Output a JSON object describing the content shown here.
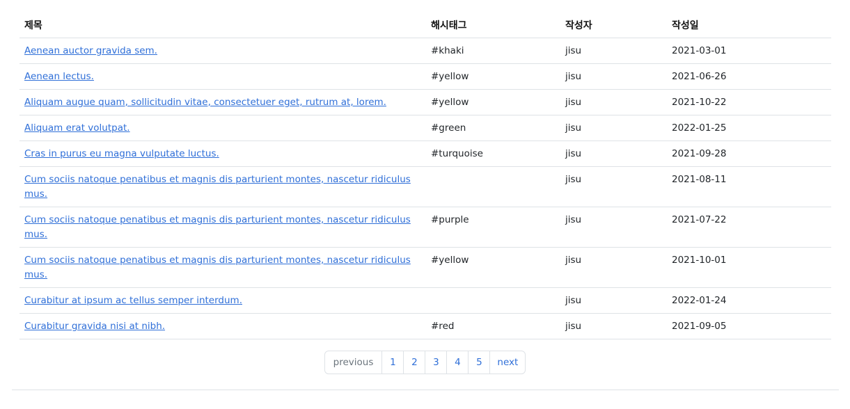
{
  "table": {
    "headers": {
      "title": "제목",
      "hashtag": "해시태그",
      "author": "작성자",
      "date": "작성일"
    },
    "rows": [
      {
        "title": "Aenean auctor gravida sem.",
        "hashtag": "#khaki",
        "author": "jisu",
        "date": "2021-03-01"
      },
      {
        "title": "Aenean lectus.",
        "hashtag": "#yellow",
        "author": "jisu",
        "date": "2021-06-26"
      },
      {
        "title": "Aliquam augue quam, sollicitudin vitae, consectetuer eget, rutrum at, lorem.",
        "hashtag": "#yellow",
        "author": "jisu",
        "date": "2021-10-22"
      },
      {
        "title": "Aliquam erat volutpat.",
        "hashtag": "#green",
        "author": "jisu",
        "date": "2022-01-25"
      },
      {
        "title": "Cras in purus eu magna vulputate luctus.",
        "hashtag": "#turquoise",
        "author": "jisu",
        "date": "2021-09-28"
      },
      {
        "title": "Cum sociis natoque penatibus et magnis dis parturient montes, nascetur ridiculus mus.",
        "hashtag": "",
        "author": "jisu",
        "date": "2021-08-11"
      },
      {
        "title": "Cum sociis natoque penatibus et magnis dis parturient montes, nascetur ridiculus mus.",
        "hashtag": "#purple",
        "author": "jisu",
        "date": "2021-07-22"
      },
      {
        "title": "Cum sociis natoque penatibus et magnis dis parturient montes, nascetur ridiculus mus.",
        "hashtag": "#yellow",
        "author": "jisu",
        "date": "2021-10-01"
      },
      {
        "title": "Curabitur at ipsum ac tellus semper interdum.",
        "hashtag": "",
        "author": "jisu",
        "date": "2022-01-24"
      },
      {
        "title": "Curabitur gravida nisi at nibh.",
        "hashtag": "#red",
        "author": "jisu",
        "date": "2021-09-05"
      }
    ]
  },
  "pagination": {
    "previous": "previous",
    "pages": [
      "1",
      "2",
      "3",
      "4",
      "5"
    ],
    "next": "next"
  },
  "colors": {
    "link": "#2f6fd8",
    "border": "#dee2e6",
    "disabled": "#6c757d"
  }
}
